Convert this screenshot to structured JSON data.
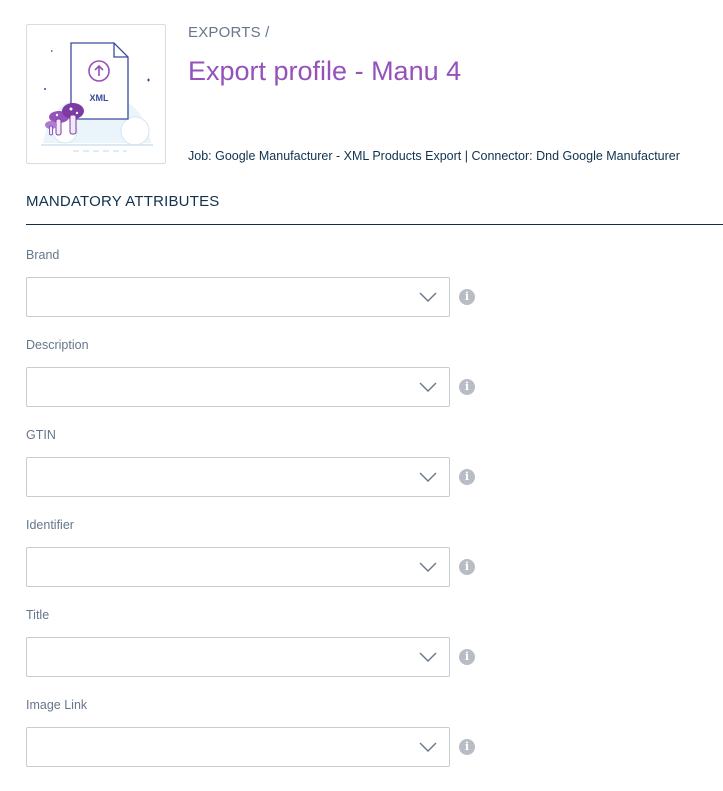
{
  "header": {
    "breadcrumb": "EXPORTS /",
    "title": "Export profile - Manu 4",
    "meta": "Job: Google Manufacturer - XML Products Export | Connector: Dnd Google Manufacturer",
    "thumbnail": {
      "icon": "xml-file-upload-illustration",
      "label": "XML"
    }
  },
  "section": {
    "title": "MANDATORY ATTRIBUTES"
  },
  "fields": [
    {
      "label": "Brand",
      "value": ""
    },
    {
      "label": "Description",
      "value": ""
    },
    {
      "label": "GTIN",
      "value": ""
    },
    {
      "label": "Identifier",
      "value": ""
    },
    {
      "label": "Title",
      "value": ""
    },
    {
      "label": "Image Link",
      "value": ""
    }
  ],
  "icons": {
    "chevron": "chevron-down-icon",
    "info": "info-icon",
    "info_glyph": "i"
  },
  "colors": {
    "title": "#9452ba",
    "text": "#11324d",
    "muted": "#67768a",
    "border": "#c7cbd4",
    "info": "#b8bcc4"
  }
}
